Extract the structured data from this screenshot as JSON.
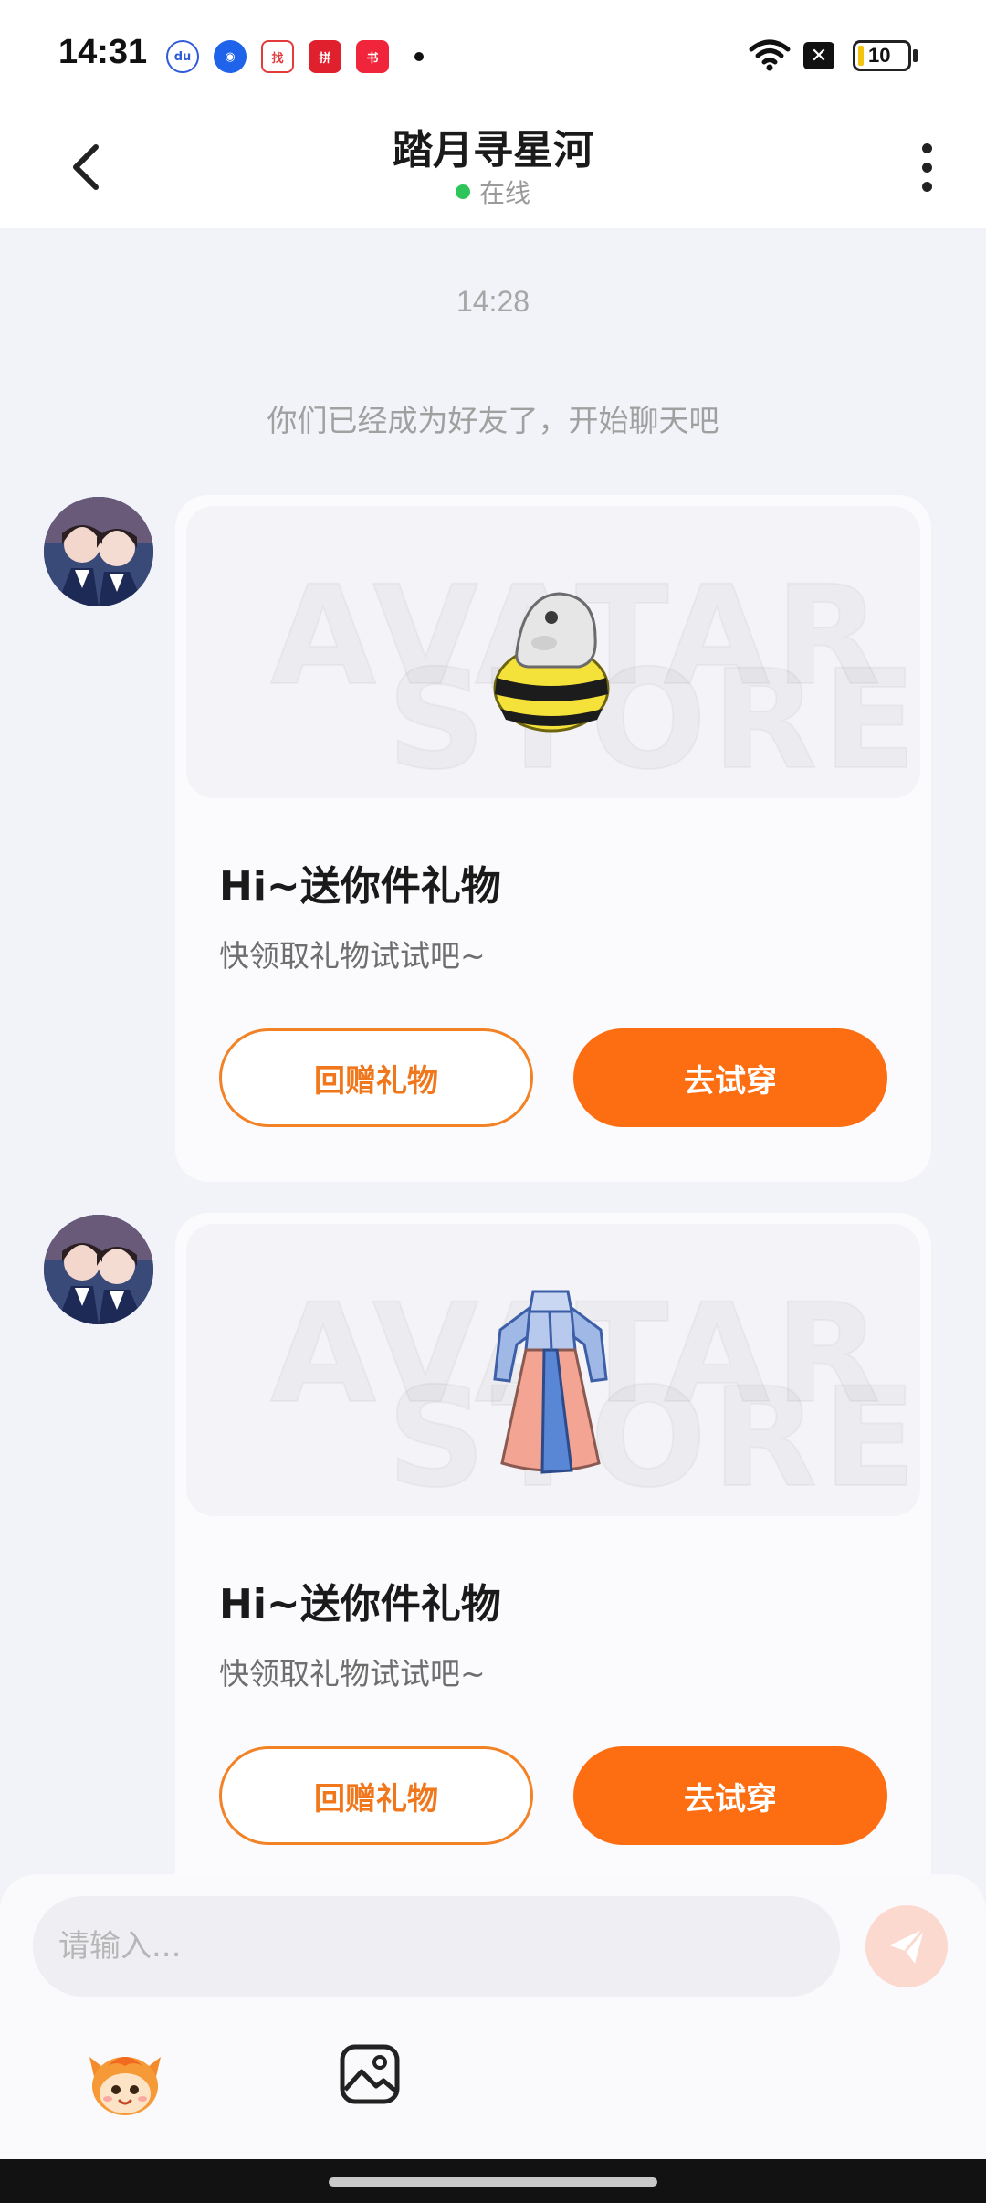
{
  "status_bar": {
    "time": "14:31",
    "app_icons": [
      {
        "name": "baidu-icon",
        "color": "#2f5bd8",
        "glyph": "du"
      },
      {
        "name": "browser-icon",
        "color": "#1e63e9",
        "glyph": "◉"
      },
      {
        "name": "douyin-video-icon",
        "color": "#e23b3b",
        "glyph": "找"
      },
      {
        "name": "pinduoduo-icon",
        "color": "#e0212d",
        "glyph": "拼"
      },
      {
        "name": "xiaohongshu-icon",
        "color": "#f0243a",
        "glyph": "书"
      }
    ],
    "battery": "10"
  },
  "header": {
    "title": "踏月寻星河",
    "status": "在线",
    "online_color": "#2ec55b"
  },
  "chat": {
    "time": "14:28",
    "system_tip": "你们已经成为好友了，开始聊天吧",
    "watermark_line1": "AVATAR",
    "watermark_line2": "STORE",
    "messages": [
      {
        "gift_item": "bee-costume",
        "title": "Hi~送你件礼物",
        "subtitle": "快领取礼物试试吧~",
        "return_gift_label": "回赠礼物",
        "try_on_label": "去试穿"
      },
      {
        "gift_item": "hanfu-dress",
        "title": "Hi~送你件礼物",
        "subtitle": "快领取礼物试试吧~",
        "return_gift_label": "回赠礼物",
        "try_on_label": "去试穿"
      }
    ]
  },
  "input": {
    "placeholder": "请输入..."
  },
  "colors": {
    "accent": "#fd6e12",
    "outline": "#f28225",
    "background": "#f2f3f8"
  }
}
